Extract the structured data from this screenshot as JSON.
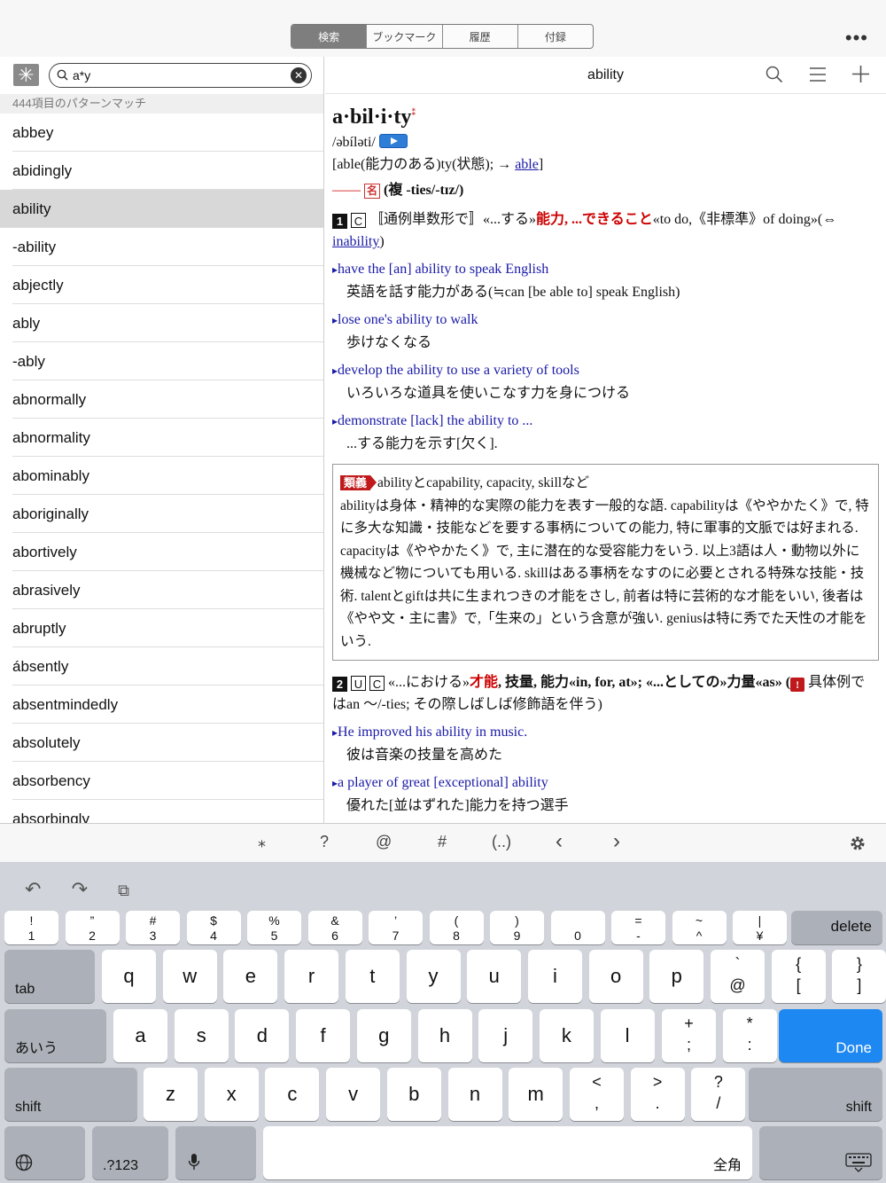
{
  "tabs": [
    "検索",
    "ブックマーク",
    "履歴",
    "付録"
  ],
  "menu_icon": "more-dots-icon",
  "search": {
    "value": "a*y",
    "match_count": "444項目のパターンマッチ"
  },
  "words": [
    "abbey",
    "abidingly",
    "ability",
    "-ability",
    "abjectly",
    "ably",
    "-ably",
    "abnormally",
    "abnormality",
    "abominably",
    "aboriginally",
    "abortively",
    "abrasively",
    "abruptly",
    "ábsently",
    "absentmindedly",
    "absolutely",
    "absorbency",
    "absorbingly"
  ],
  "entry_title": "ability",
  "entry": {
    "headword": "a·bil·i·ty",
    "pron": "/əbíləti/",
    "etym_a": "[able(能力のある)ty(状態); → ",
    "etym_link": "able",
    "etym_b": "]",
    "pos_dash": "——",
    "pos": "名",
    "plural": "(複 -ties/-tɪz/)",
    "s1_num": "1",
    "s1_mark": "C",
    "s1_a": "〚通例単数形で〛«...する»",
    "s1_b": "能力, ...できること",
    "s1_c": "«to do,《非標準》of doing»(⇔ ",
    "s1_link": "inability",
    "s1_d": ")",
    "ex1_en": "have the [an] ability to speak English",
    "ex1_ja": "英語を話す能力がある(≒can [be able to] speak English)",
    "ex2_en": "lose one's ability to walk",
    "ex2_ja": "歩けなくなる",
    "ex3_en": "develop the ability to use a variety of tools",
    "ex3_ja": "いろいろな道具を使いこなす力を身につける",
    "ex4_en": "demonstrate [lack] the ability to ...",
    "ex4_ja": "...する能力を示す[欠く].",
    "note_tag": "類義",
    "note_head": "abilityとcapability, capacity, skillなど",
    "note_body": "abilityは身体・精神的な実際の能力を表す一般的な語. capabilityは《ややかたく》で, 特に多大な知識・技能などを要する事柄についての能力, 特に軍事的文脈では好まれる. capacityは《ややかたく》で, 主に潜在的な受容能力をいう. 以上3語は人・動物以外に機械など物についても用いる. skillはある事柄をなすのに必要とされる特殊な技能・技術. talentとgiftは共に生まれつきの才能をさし, 前者は特に芸術的な才能をいい, 後者は《やや文・主に書》で,「生来の」という含意が強い. geniusは特に秀でた天性の才能をいう.",
    "s2_num": "2",
    "s2_mark1": "U",
    "s2_mark2": "C",
    "s2_a": "«...における»",
    "s2_b": "才能",
    "s2_c": ", 技量, 能力«in, for, at»; «...としての»力量«as» (",
    "s2_d": "具体例ではan 〜/-ties; その際しばしば修飾語を伴う)",
    "ex5_en": "He improved his ability in music.",
    "ex5_ja": "彼は音楽の技量を高めた",
    "ex6_en": "a player of great [exceptional] ability",
    "ex6_ja": "優れた[並はずれた]能力を持つ選手"
  },
  "accessory": [
    "⁎",
    "?",
    "@",
    "#",
    "(..)",
    "‹",
    "›"
  ],
  "keyboard": {
    "numrow": [
      [
        "!",
        "1"
      ],
      [
        "”",
        "2"
      ],
      [
        "#",
        "3"
      ],
      [
        "$",
        "4"
      ],
      [
        "%",
        "5"
      ],
      [
        "&",
        "6"
      ],
      [
        "’",
        "7"
      ],
      [
        "(",
        "8"
      ],
      [
        ")",
        "9"
      ],
      [
        "",
        "0"
      ],
      [
        "=",
        "-"
      ],
      [
        "~",
        "^"
      ],
      [
        "|",
        "¥"
      ]
    ],
    "delete": "delete",
    "tab": "tab",
    "row1": [
      "q",
      "w",
      "e",
      "r",
      "t",
      "y",
      "u",
      "i",
      "o",
      "p"
    ],
    "row1_extra": [
      [
        "`",
        "@"
      ],
      [
        "{",
        "["
      ],
      [
        "}",
        "]"
      ]
    ],
    "kana": "あいう",
    "row2": [
      "a",
      "s",
      "d",
      "f",
      "g",
      "h",
      "j",
      "k",
      "l"
    ],
    "row2_extra": [
      [
        "+",
        ";"
      ],
      [
        "*",
        ":"
      ]
    ],
    "done": "Done",
    "shift": "shift",
    "row3": [
      "z",
      "x",
      "c",
      "v",
      "b",
      "n",
      "m"
    ],
    "row3_extra": [
      [
        "<",
        ","
      ],
      [
        ">",
        "."
      ],
      [
        "?",
        "/"
      ]
    ],
    "num_switch": ".?123",
    "space": "全角"
  }
}
